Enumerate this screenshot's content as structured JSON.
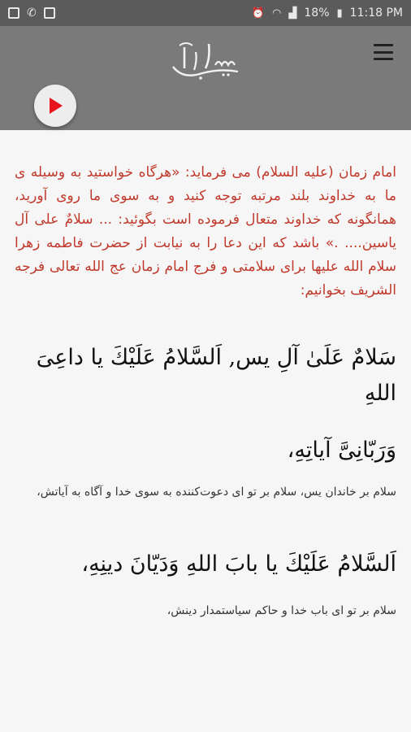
{
  "status_bar": {
    "battery": "18%",
    "time": "11:18 PM",
    "icons": [
      "image-icon",
      "phone-icon",
      "notification-icon",
      "alarm-icon",
      "wifi-icon",
      "signal-icon",
      "battery-icon"
    ]
  },
  "header": {
    "logo_text": "آل یاسین",
    "menu_icon": "hamburger-menu-icon",
    "play_icon": "play-icon",
    "play_color": "#e8141b"
  },
  "content": {
    "intro": "امام زمان (علیه السلام) می فرماید: «هرگاه خواستید به وسیله ی ما به خداوند بلند مرتبه توجه کنید و به سوی ما روی آورید، همانگونه که خداوند متعال فرموده است بگوئید: ... سلامٌ علی آل یاسین.... .» باشد که این دعا را به نیابت از حضرت فاطمه زهرا سلام الله علیها برای سلامتی و فرج امام زمان عج الله تعالی فرجه الشریف بخوانیم:",
    "verses": [
      {
        "arabic_line1": "سَلامٌ عَلَیٰ آلِ یس, اَلسَّلامُ عَلَیْكَ یا داعِیَ اللهِ",
        "arabic_line2": "وَرَبّانِیَّ آیاتِهِ،",
        "translation": "سلام بر خاندان یس، سلام بر تو ای دعوت‌کننده به سوی خدا و آگاه به آیاتش،"
      },
      {
        "arabic_line1": "اَلسَّلامُ عَلَیْكَ یا بابَ اللهِ وَدَیّانَ دینِهِ،",
        "translation": "سلام بر تو ای باب خدا و حاکم سیاستمدار دینش،"
      }
    ]
  },
  "colors": {
    "intro_text": "#c0392b",
    "toolbar": "#7a7a7a",
    "status_bar": "#5b5b5b",
    "background": "#f6f6f6"
  }
}
